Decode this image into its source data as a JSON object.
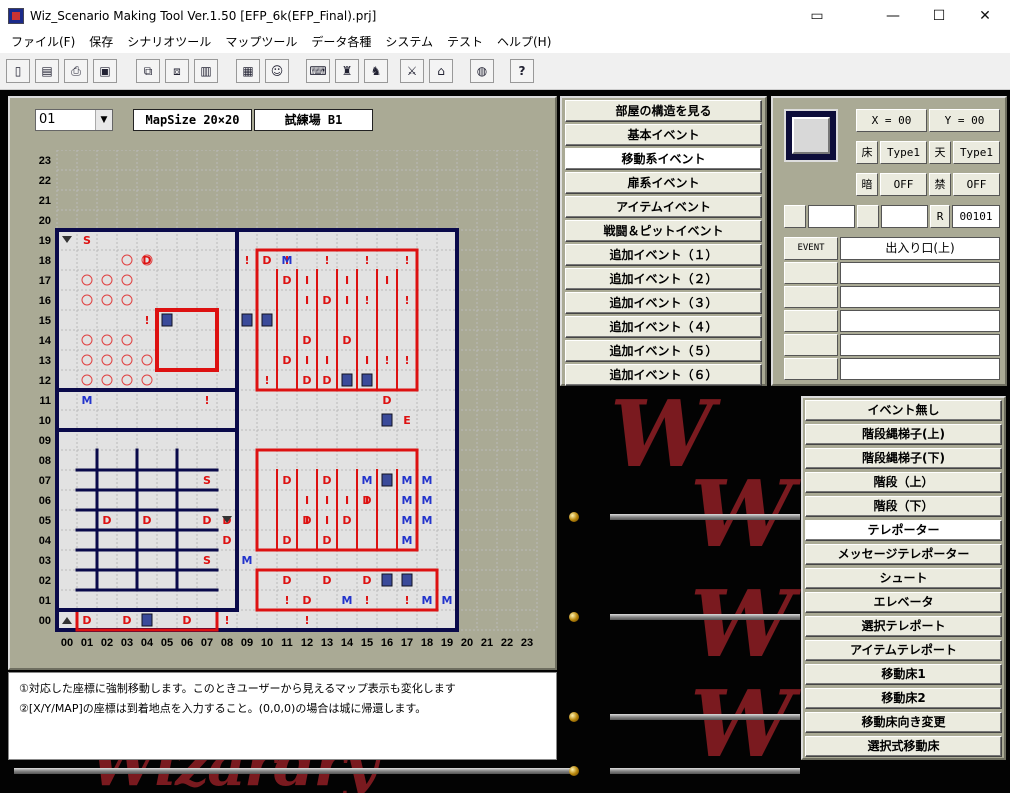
{
  "window": {
    "title": "Wiz_Scenario Making Tool Ver.1.50 [EFP_6k(EFP_Final).prj]"
  },
  "menu": [
    "ファイル(F)",
    "保存",
    "シナリオツール",
    "マップツール",
    "データ各種",
    "システム",
    "テスト",
    "ヘルプ(H)"
  ],
  "toolbar": {
    "icons": [
      "new-file-icon",
      "open-folder-icon",
      "print-icon",
      "save-icon",
      "copy-icon",
      "paste-icon",
      "clipboard-icon",
      "map-icon",
      "character-icon",
      "keyboard-icon",
      "item-icon",
      "monster-icon",
      "weapon-icon",
      "shop-icon",
      "gamepad-icon",
      "help-icon"
    ],
    "help_label": "?"
  },
  "map": {
    "floor_value": "01",
    "size_label": "MapSize 20×20",
    "map_name": "試練場 B1",
    "y_labels": [
      "23",
      "22",
      "21",
      "20",
      "19",
      "18",
      "17",
      "16",
      "15",
      "14",
      "13",
      "12",
      "11",
      "10",
      "09",
      "08",
      "07",
      "06",
      "05",
      "04",
      "03",
      "02",
      "01",
      "00"
    ],
    "x_labels": [
      "00",
      "01",
      "02",
      "03",
      "04",
      "05",
      "06",
      "07",
      "08",
      "09",
      "10",
      "11",
      "12",
      "13",
      "14",
      "15",
      "16",
      "17",
      "18",
      "19",
      "20",
      "21",
      "22",
      "23"
    ]
  },
  "help": [
    "①対応した座標に強制移動します。このときユーザーから見えるマップ表示も変化します",
    "②[X/Y/MAP]の座標は到着地点を入力すること。(0,0,0)の場合は城に帰還します。"
  ],
  "event_categories": {
    "items": [
      "部屋の構造を見る",
      "基本イベント",
      "移動系イベント",
      "扉系イベント",
      "アイテムイベント",
      "戦闘＆ピットイベント",
      "追加イベント（１）",
      "追加イベント（２）",
      "追加イベント（３）",
      "追加イベント（４）",
      "追加イベント（５）",
      "追加イベント（６）"
    ],
    "selected_index": 2
  },
  "info": {
    "x_label": "X = 00",
    "y_label": "Y = 00",
    "floor_label": "床",
    "floor_value": "Type1",
    "ceiling_label": "天",
    "ceiling_value": "Type1",
    "dark_label": "暗",
    "dark_value": "OFF",
    "forbid_label": "禁",
    "forbid_value": "OFF",
    "r_label": "R",
    "r_value": "00101",
    "event_label": "EVENT",
    "event_value": "出入り口(上)"
  },
  "event_types": {
    "items": [
      "イベント無し",
      "階段縄梯子(上)",
      "階段縄梯子(下)",
      "階段（上）",
      "階段（下）",
      "テレポーター",
      "メッセージテレポーター",
      "シュート",
      "エレベータ",
      "選択テレポート",
      "アイテムテレポート",
      "移動床1",
      "移動床2",
      "移動床向き変更",
      "選択式移動床"
    ],
    "selected_index": 5
  },
  "colors": {
    "panel": "#aaaa95",
    "wall": "#0a0a4a",
    "door": "#dd1111",
    "background": "#030303",
    "logo": "#7a1a1f"
  }
}
